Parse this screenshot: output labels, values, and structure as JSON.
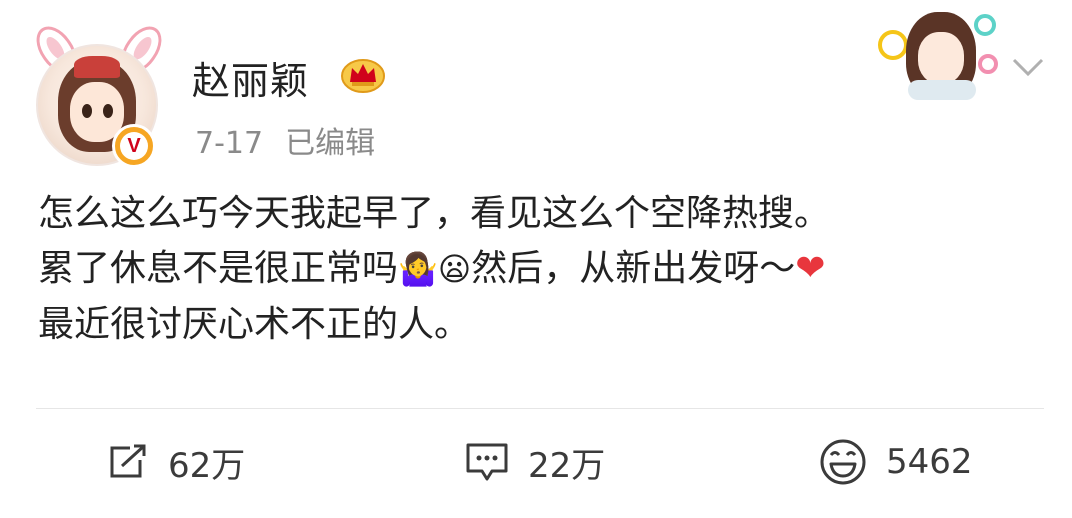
{
  "user": {
    "name": "赵丽颖",
    "time": "7-17",
    "edited": "已编辑"
  },
  "post": {
    "line1": "怎么这么巧今天我起早了，看见这么个空降热搜。",
    "line2_a": "累了休息不是很正常吗",
    "line2_emoji1": "🤷‍♀️",
    "line2_emoji2": "😦",
    "line2_b": "然后，从新出发呀～",
    "line2_heart": "❤",
    "line3": "最近很讨厌心术不正的人。"
  },
  "actions": {
    "repost_count": "62万",
    "comment_count": "22万",
    "like_count": "5462"
  },
  "icons": {
    "avatar": "cartoon-girl-avatar",
    "verified": "verified-badge-icon",
    "vip": "crown-icon",
    "decoration": "girl-sticker-decoration",
    "menu": "chevron-down-icon",
    "repost": "repost-icon",
    "comment": "comment-icon",
    "like": "smile-like-icon"
  },
  "colors": {
    "text": "#222222",
    "meta": "#8a8a8a",
    "verified_bg": "#f6a623",
    "heart": "#e8363d"
  }
}
